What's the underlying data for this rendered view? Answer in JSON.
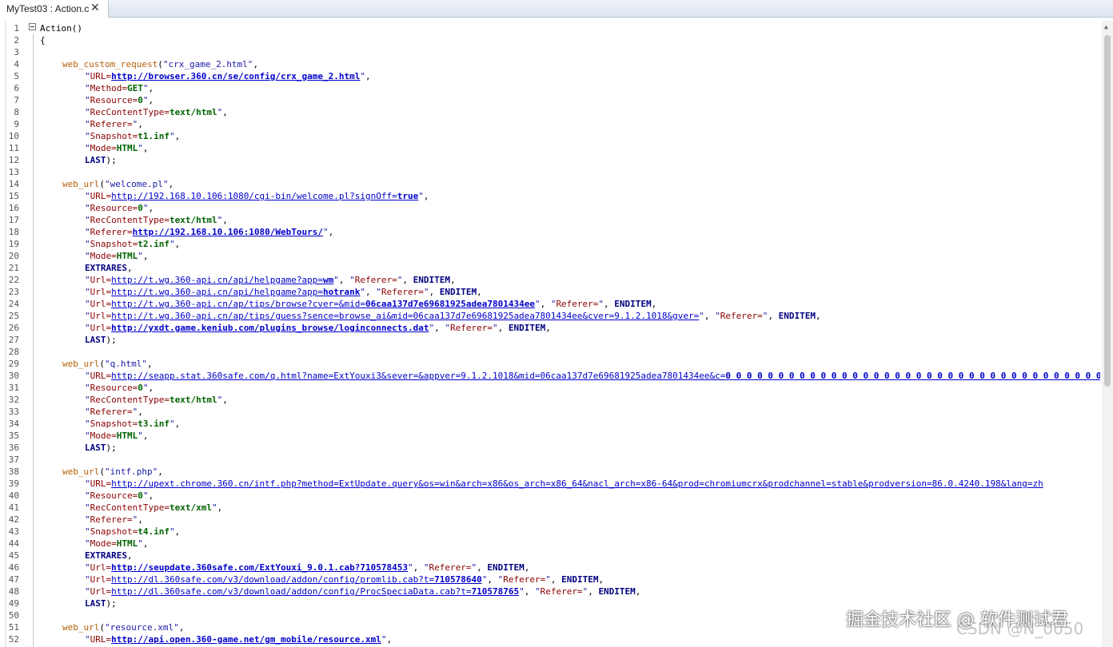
{
  "tab": {
    "title": "MyTest03 : Action.c",
    "close": "✕"
  },
  "watermark": {
    "primary": "掘金技术社区 @ 软件测试君",
    "secondary": "CSDN @N_0050"
  },
  "code_lines": [
    [
      [
        "plain",
        "Action()"
      ]
    ],
    [
      [
        "plain",
        "{"
      ]
    ],
    [],
    [
      [
        "fn",
        "web_custom_request"
      ],
      [
        "plain",
        "("
      ],
      [
        "str",
        "\"crx_game_2.html\""
      ],
      [
        "plain",
        ","
      ]
    ],
    [
      [
        "str",
        "\""
      ],
      [
        "key",
        "URL="
      ],
      [
        "urlb",
        "http://browser.360.cn/se/config/crx_game_2.html"
      ],
      [
        "str",
        "\""
      ],
      [
        "plain",
        ","
      ]
    ],
    [
      [
        "str",
        "\""
      ],
      [
        "key",
        "Method="
      ],
      [
        "val",
        "GET"
      ],
      [
        "str",
        "\""
      ],
      [
        "plain",
        ","
      ]
    ],
    [
      [
        "str",
        "\""
      ],
      [
        "key",
        "Resource="
      ],
      [
        "val",
        "0"
      ],
      [
        "str",
        "\""
      ],
      [
        "plain",
        ","
      ]
    ],
    [
      [
        "str",
        "\""
      ],
      [
        "key",
        "RecContentType="
      ],
      [
        "val",
        "text/html"
      ],
      [
        "str",
        "\""
      ],
      [
        "plain",
        ","
      ]
    ],
    [
      [
        "str",
        "\""
      ],
      [
        "key",
        "Referer="
      ],
      [
        "str",
        "\""
      ],
      [
        "plain",
        ","
      ]
    ],
    [
      [
        "str",
        "\""
      ],
      [
        "key",
        "Snapshot="
      ],
      [
        "val",
        "t1.inf"
      ],
      [
        "str",
        "\""
      ],
      [
        "plain",
        ","
      ]
    ],
    [
      [
        "str",
        "\""
      ],
      [
        "key",
        "Mode="
      ],
      [
        "val",
        "HTML"
      ],
      [
        "str",
        "\""
      ],
      [
        "plain",
        ","
      ]
    ],
    [
      [
        "kw",
        "LAST"
      ],
      [
        "plain",
        ");"
      ]
    ],
    [],
    [
      [
        "fn",
        "web_url"
      ],
      [
        "plain",
        "("
      ],
      [
        "str",
        "\"welcome.pl\""
      ],
      [
        "plain",
        ","
      ]
    ],
    [
      [
        "str",
        "\""
      ],
      [
        "key",
        "URL="
      ],
      [
        "url",
        "http://192.168.10.106:1080/cgi-bin/welcome.pl?signOff="
      ],
      [
        "urlb",
        "true"
      ],
      [
        "str",
        "\""
      ],
      [
        "plain",
        ","
      ]
    ],
    [
      [
        "str",
        "\""
      ],
      [
        "key",
        "Resource="
      ],
      [
        "val",
        "0"
      ],
      [
        "str",
        "\""
      ],
      [
        "plain",
        ","
      ]
    ],
    [
      [
        "str",
        "\""
      ],
      [
        "key",
        "RecContentType="
      ],
      [
        "val",
        "text/html"
      ],
      [
        "str",
        "\""
      ],
      [
        "plain",
        ","
      ]
    ],
    [
      [
        "str",
        "\""
      ],
      [
        "key",
        "Referer="
      ],
      [
        "urlb",
        "http://192.168.10.106:1080/WebTours/"
      ],
      [
        "str",
        "\""
      ],
      [
        "plain",
        ","
      ]
    ],
    [
      [
        "str",
        "\""
      ],
      [
        "key",
        "Snapshot="
      ],
      [
        "val",
        "t2.inf"
      ],
      [
        "str",
        "\""
      ],
      [
        "plain",
        ","
      ]
    ],
    [
      [
        "str",
        "\""
      ],
      [
        "key",
        "Mode="
      ],
      [
        "val",
        "HTML"
      ],
      [
        "str",
        "\""
      ],
      [
        "plain",
        ","
      ]
    ],
    [
      [
        "kw",
        "EXTRARES"
      ],
      [
        "plain",
        ","
      ]
    ],
    [
      [
        "str",
        "\""
      ],
      [
        "key",
        "Url="
      ],
      [
        "url",
        "http://t.wg.360-api.cn/api/helpgame?app="
      ],
      [
        "urlb",
        "wm"
      ],
      [
        "str",
        "\""
      ],
      [
        "plain",
        ", "
      ],
      [
        "str",
        "\""
      ],
      [
        "key",
        "Referer="
      ],
      [
        "str",
        "\""
      ],
      [
        "plain",
        ", "
      ],
      [
        "kw",
        "ENDITEM"
      ],
      [
        "plain",
        ","
      ]
    ],
    [
      [
        "str",
        "\""
      ],
      [
        "key",
        "Url="
      ],
      [
        "url",
        "http://t.wg.360-api.cn/api/helpgame?app="
      ],
      [
        "urlb",
        "hotrank"
      ],
      [
        "str",
        "\""
      ],
      [
        "plain",
        ", "
      ],
      [
        "str",
        "\""
      ],
      [
        "key",
        "Referer="
      ],
      [
        "str",
        "\""
      ],
      [
        "plain",
        ", "
      ],
      [
        "kw",
        "ENDITEM"
      ],
      [
        "plain",
        ","
      ]
    ],
    [
      [
        "str",
        "\""
      ],
      [
        "key",
        "Url="
      ],
      [
        "url",
        "http://t.wg.360-api.cn/ap/tips/browse?cver=&mid="
      ],
      [
        "urlb",
        "06caa137d7e69681925adea7801434ee"
      ],
      [
        "str",
        "\""
      ],
      [
        "plain",
        ", "
      ],
      [
        "str",
        "\""
      ],
      [
        "key",
        "Referer="
      ],
      [
        "str",
        "\""
      ],
      [
        "plain",
        ", "
      ],
      [
        "kw",
        "ENDITEM"
      ],
      [
        "plain",
        ","
      ]
    ],
    [
      [
        "str",
        "\""
      ],
      [
        "key",
        "Url="
      ],
      [
        "url",
        "http://t.wg.360-api.cn/ap/tips/guess?sence=browse_ai&mid=06caa137d7e69681925adea7801434ee&cver=9.1.2.1018&gver="
      ],
      [
        "str",
        "\""
      ],
      [
        "plain",
        ", "
      ],
      [
        "str",
        "\""
      ],
      [
        "key",
        "Referer="
      ],
      [
        "str",
        "\""
      ],
      [
        "plain",
        ", "
      ],
      [
        "kw",
        "ENDITEM"
      ],
      [
        "plain",
        ","
      ]
    ],
    [
      [
        "str",
        "\""
      ],
      [
        "key",
        "Url="
      ],
      [
        "urlb",
        "http://yxdt.game.keniub.com/plugins_browse/loginconnects.dat"
      ],
      [
        "str",
        "\""
      ],
      [
        "plain",
        ", "
      ],
      [
        "str",
        "\""
      ],
      [
        "key",
        "Referer="
      ],
      [
        "str",
        "\""
      ],
      [
        "plain",
        ", "
      ],
      [
        "kw",
        "ENDITEM"
      ],
      [
        "plain",
        ","
      ]
    ],
    [
      [
        "kw",
        "LAST"
      ],
      [
        "plain",
        ");"
      ]
    ],
    [],
    [
      [
        "fn",
        "web_url"
      ],
      [
        "plain",
        "("
      ],
      [
        "str",
        "\"q.html\""
      ],
      [
        "plain",
        ","
      ]
    ],
    [
      [
        "str",
        "\""
      ],
      [
        "key",
        "URL="
      ],
      [
        "url",
        "http://seapp.stat.360safe.com/q.html?name=ExtYouxi3&sever=&appver=9.1.2.1018&mid=06caa137d7e69681925adea7801434ee&c="
      ],
      [
        "urlb",
        "0 0 0 0 0 0 0 0 0 0 0 0 0 0 0 0 0 0 0 0 0 0 0 0 0 0 0 0 0 0 0 0 0 0 0 0 0 0 0 0 0"
      ]
    ],
    [
      [
        "str",
        "\""
      ],
      [
        "key",
        "Resource="
      ],
      [
        "val",
        "0"
      ],
      [
        "str",
        "\""
      ],
      [
        "plain",
        ","
      ]
    ],
    [
      [
        "str",
        "\""
      ],
      [
        "key",
        "RecContentType="
      ],
      [
        "val",
        "text/html"
      ],
      [
        "str",
        "\""
      ],
      [
        "plain",
        ","
      ]
    ],
    [
      [
        "str",
        "\""
      ],
      [
        "key",
        "Referer="
      ],
      [
        "str",
        "\""
      ],
      [
        "plain",
        ","
      ]
    ],
    [
      [
        "str",
        "\""
      ],
      [
        "key",
        "Snapshot="
      ],
      [
        "val",
        "t3.inf"
      ],
      [
        "str",
        "\""
      ],
      [
        "plain",
        ","
      ]
    ],
    [
      [
        "str",
        "\""
      ],
      [
        "key",
        "Mode="
      ],
      [
        "val",
        "HTML"
      ],
      [
        "str",
        "\""
      ],
      [
        "plain",
        ","
      ]
    ],
    [
      [
        "kw",
        "LAST"
      ],
      [
        "plain",
        ");"
      ]
    ],
    [],
    [
      [
        "fn",
        "web_url"
      ],
      [
        "plain",
        "("
      ],
      [
        "str",
        "\"intf.php\""
      ],
      [
        "plain",
        ","
      ]
    ],
    [
      [
        "str",
        "\""
      ],
      [
        "key",
        "URL="
      ],
      [
        "url",
        "http://upext.chrome.360.cn/intf.php?method=ExtUpdate.query&os=win&arch=x86&os_arch=x86_64&nacl_arch=x86-64&prod=chromiumcrx&prodchannel=stable&prodversion=86.0.4240.198&lang=zh"
      ]
    ],
    [
      [
        "str",
        "\""
      ],
      [
        "key",
        "Resource="
      ],
      [
        "val",
        "0"
      ],
      [
        "str",
        "\""
      ],
      [
        "plain",
        ","
      ]
    ],
    [
      [
        "str",
        "\""
      ],
      [
        "key",
        "RecContentType="
      ],
      [
        "val",
        "text/xml"
      ],
      [
        "str",
        "\""
      ],
      [
        "plain",
        ","
      ]
    ],
    [
      [
        "str",
        "\""
      ],
      [
        "key",
        "Referer="
      ],
      [
        "str",
        "\""
      ],
      [
        "plain",
        ","
      ]
    ],
    [
      [
        "str",
        "\""
      ],
      [
        "key",
        "Snapshot="
      ],
      [
        "val",
        "t4.inf"
      ],
      [
        "str",
        "\""
      ],
      [
        "plain",
        ","
      ]
    ],
    [
      [
        "str",
        "\""
      ],
      [
        "key",
        "Mode="
      ],
      [
        "val",
        "HTML"
      ],
      [
        "str",
        "\""
      ],
      [
        "plain",
        ","
      ]
    ],
    [
      [
        "kw",
        "EXTRARES"
      ],
      [
        "plain",
        ","
      ]
    ],
    [
      [
        "str",
        "\""
      ],
      [
        "key",
        "Url="
      ],
      [
        "urlb",
        "http://seupdate.360safe.com/ExtYouxi_9.0.1.cab?710578453"
      ],
      [
        "str",
        "\""
      ],
      [
        "plain",
        ", "
      ],
      [
        "str",
        "\""
      ],
      [
        "key",
        "Referer="
      ],
      [
        "str",
        "\""
      ],
      [
        "plain",
        ", "
      ],
      [
        "kw",
        "ENDITEM"
      ],
      [
        "plain",
        ","
      ]
    ],
    [
      [
        "str",
        "\""
      ],
      [
        "key",
        "Url="
      ],
      [
        "url",
        "http://dl.360safe.com/v3/download/addon/config/promlib.cab?t="
      ],
      [
        "urlb",
        "710578640"
      ],
      [
        "str",
        "\""
      ],
      [
        "plain",
        ", "
      ],
      [
        "str",
        "\""
      ],
      [
        "key",
        "Referer="
      ],
      [
        "str",
        "\""
      ],
      [
        "plain",
        ", "
      ],
      [
        "kw",
        "ENDITEM"
      ],
      [
        "plain",
        ","
      ]
    ],
    [
      [
        "str",
        "\""
      ],
      [
        "key",
        "Url="
      ],
      [
        "url",
        "http://dl.360safe.com/v3/download/addon/config/ProcSpeciaData.cab?t="
      ],
      [
        "urlb",
        "710578765"
      ],
      [
        "str",
        "\""
      ],
      [
        "plain",
        ", "
      ],
      [
        "str",
        "\""
      ],
      [
        "key",
        "Referer="
      ],
      [
        "str",
        "\""
      ],
      [
        "plain",
        ", "
      ],
      [
        "kw",
        "ENDITEM"
      ],
      [
        "plain",
        ","
      ]
    ],
    [
      [
        "kw",
        "LAST"
      ],
      [
        "plain",
        ");"
      ]
    ],
    [],
    [
      [
        "fn",
        "web_url"
      ],
      [
        "plain",
        "("
      ],
      [
        "str",
        "\"resource.xml\""
      ],
      [
        "plain",
        ","
      ]
    ],
    [
      [
        "str",
        "\""
      ],
      [
        "key",
        "URL="
      ],
      [
        "urlb",
        "http://api.open.360-game.net/gm_mobile/resource.xml"
      ],
      [
        "str",
        "\""
      ],
      [
        "plain",
        ","
      ]
    ]
  ]
}
